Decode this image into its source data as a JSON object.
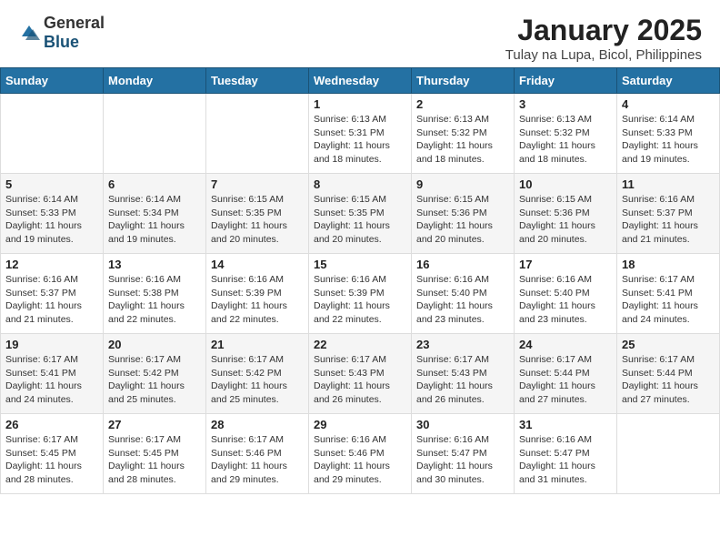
{
  "header": {
    "logo_general": "General",
    "logo_blue": "Blue",
    "month": "January 2025",
    "location": "Tulay na Lupa, Bicol, Philippines"
  },
  "weekdays": [
    "Sunday",
    "Monday",
    "Tuesday",
    "Wednesday",
    "Thursday",
    "Friday",
    "Saturday"
  ],
  "weeks": [
    [
      null,
      null,
      null,
      {
        "day": 1,
        "sunrise": "6:13 AM",
        "sunset": "5:31 PM",
        "daylight": "11 hours and 18 minutes."
      },
      {
        "day": 2,
        "sunrise": "6:13 AM",
        "sunset": "5:32 PM",
        "daylight": "11 hours and 18 minutes."
      },
      {
        "day": 3,
        "sunrise": "6:13 AM",
        "sunset": "5:32 PM",
        "daylight": "11 hours and 18 minutes."
      },
      {
        "day": 4,
        "sunrise": "6:14 AM",
        "sunset": "5:33 PM",
        "daylight": "11 hours and 19 minutes."
      }
    ],
    [
      {
        "day": 5,
        "sunrise": "6:14 AM",
        "sunset": "5:33 PM",
        "daylight": "11 hours and 19 minutes."
      },
      {
        "day": 6,
        "sunrise": "6:14 AM",
        "sunset": "5:34 PM",
        "daylight": "11 hours and 19 minutes."
      },
      {
        "day": 7,
        "sunrise": "6:15 AM",
        "sunset": "5:35 PM",
        "daylight": "11 hours and 20 minutes."
      },
      {
        "day": 8,
        "sunrise": "6:15 AM",
        "sunset": "5:35 PM",
        "daylight": "11 hours and 20 minutes."
      },
      {
        "day": 9,
        "sunrise": "6:15 AM",
        "sunset": "5:36 PM",
        "daylight": "11 hours and 20 minutes."
      },
      {
        "day": 10,
        "sunrise": "6:15 AM",
        "sunset": "5:36 PM",
        "daylight": "11 hours and 20 minutes."
      },
      {
        "day": 11,
        "sunrise": "6:16 AM",
        "sunset": "5:37 PM",
        "daylight": "11 hours and 21 minutes."
      }
    ],
    [
      {
        "day": 12,
        "sunrise": "6:16 AM",
        "sunset": "5:37 PM",
        "daylight": "11 hours and 21 minutes."
      },
      {
        "day": 13,
        "sunrise": "6:16 AM",
        "sunset": "5:38 PM",
        "daylight": "11 hours and 22 minutes."
      },
      {
        "day": 14,
        "sunrise": "6:16 AM",
        "sunset": "5:39 PM",
        "daylight": "11 hours and 22 minutes."
      },
      {
        "day": 15,
        "sunrise": "6:16 AM",
        "sunset": "5:39 PM",
        "daylight": "11 hours and 22 minutes."
      },
      {
        "day": 16,
        "sunrise": "6:16 AM",
        "sunset": "5:40 PM",
        "daylight": "11 hours and 23 minutes."
      },
      {
        "day": 17,
        "sunrise": "6:16 AM",
        "sunset": "5:40 PM",
        "daylight": "11 hours and 23 minutes."
      },
      {
        "day": 18,
        "sunrise": "6:17 AM",
        "sunset": "5:41 PM",
        "daylight": "11 hours and 24 minutes."
      }
    ],
    [
      {
        "day": 19,
        "sunrise": "6:17 AM",
        "sunset": "5:41 PM",
        "daylight": "11 hours and 24 minutes."
      },
      {
        "day": 20,
        "sunrise": "6:17 AM",
        "sunset": "5:42 PM",
        "daylight": "11 hours and 25 minutes."
      },
      {
        "day": 21,
        "sunrise": "6:17 AM",
        "sunset": "5:42 PM",
        "daylight": "11 hours and 25 minutes."
      },
      {
        "day": 22,
        "sunrise": "6:17 AM",
        "sunset": "5:43 PM",
        "daylight": "11 hours and 26 minutes."
      },
      {
        "day": 23,
        "sunrise": "6:17 AM",
        "sunset": "5:43 PM",
        "daylight": "11 hours and 26 minutes."
      },
      {
        "day": 24,
        "sunrise": "6:17 AM",
        "sunset": "5:44 PM",
        "daylight": "11 hours and 27 minutes."
      },
      {
        "day": 25,
        "sunrise": "6:17 AM",
        "sunset": "5:44 PM",
        "daylight": "11 hours and 27 minutes."
      }
    ],
    [
      {
        "day": 26,
        "sunrise": "6:17 AM",
        "sunset": "5:45 PM",
        "daylight": "11 hours and 28 minutes."
      },
      {
        "day": 27,
        "sunrise": "6:17 AM",
        "sunset": "5:45 PM",
        "daylight": "11 hours and 28 minutes."
      },
      {
        "day": 28,
        "sunrise": "6:17 AM",
        "sunset": "5:46 PM",
        "daylight": "11 hours and 29 minutes."
      },
      {
        "day": 29,
        "sunrise": "6:16 AM",
        "sunset": "5:46 PM",
        "daylight": "11 hours and 29 minutes."
      },
      {
        "day": 30,
        "sunrise": "6:16 AM",
        "sunset": "5:47 PM",
        "daylight": "11 hours and 30 minutes."
      },
      {
        "day": 31,
        "sunrise": "6:16 AM",
        "sunset": "5:47 PM",
        "daylight": "11 hours and 31 minutes."
      },
      null
    ]
  ],
  "labels": {
    "sunrise_prefix": "Sunrise: ",
    "sunset_prefix": "Sunset: ",
    "daylight_label": "Daylight hours"
  }
}
